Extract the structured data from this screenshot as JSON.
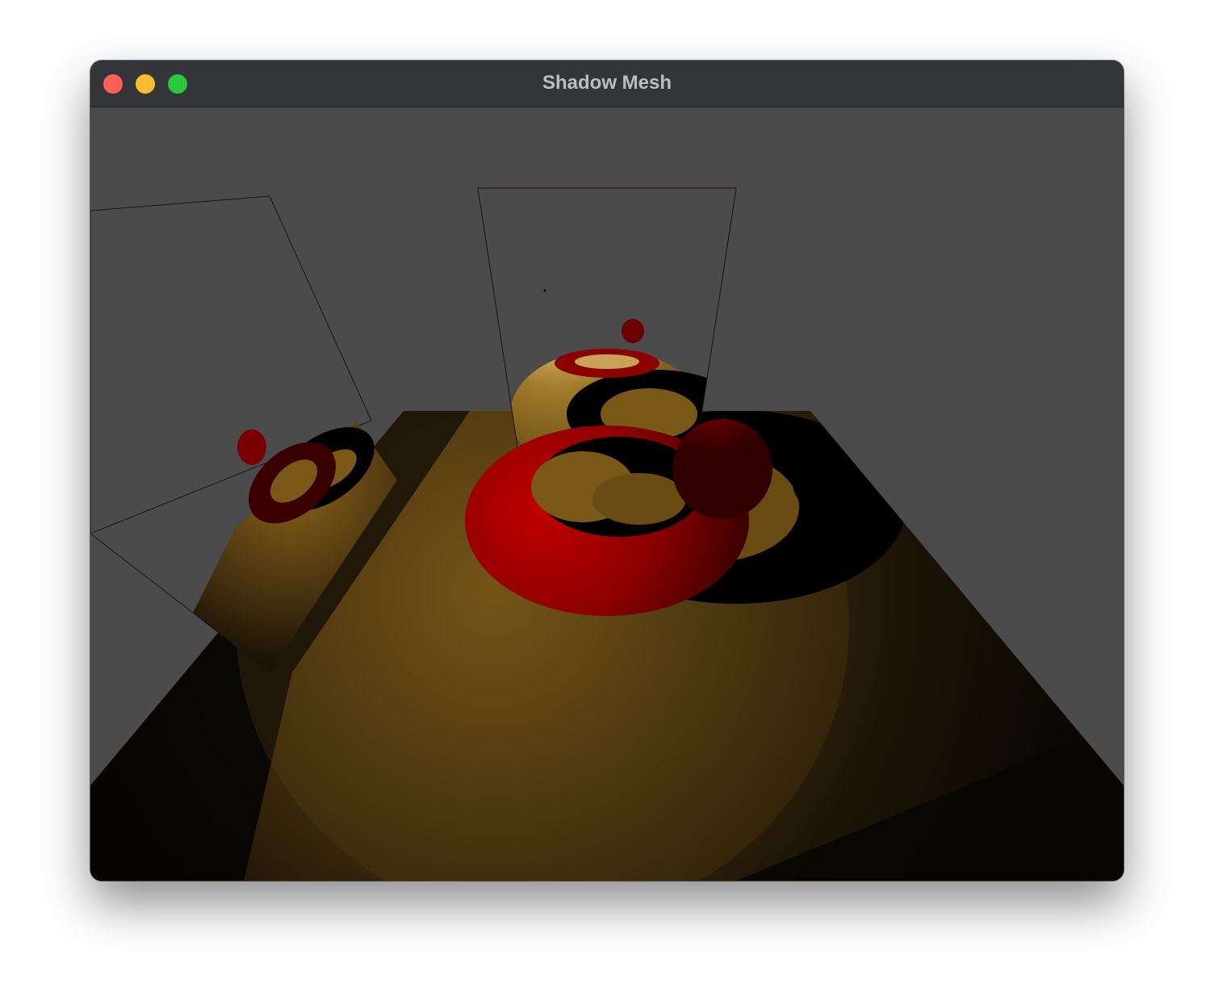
{
  "window": {
    "title": "Shadow Mesh",
    "controls": {
      "close_icon": "close-icon",
      "minimize_icon": "minimize-icon",
      "zoom_icon": "zoom-icon"
    }
  },
  "scene": {
    "background_color": "#4b4b4b",
    "floor_color": "#7a5818",
    "torus_color": "#8b0000",
    "sphere_color": "#6a0000",
    "shadow_color": "#000000"
  }
}
